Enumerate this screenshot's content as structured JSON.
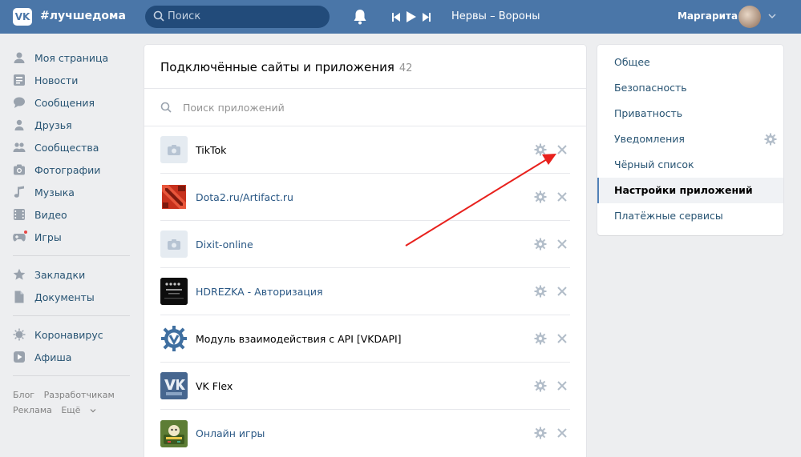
{
  "topbar": {
    "logo_text": "VK",
    "hashtag": "#лучшедома",
    "search_placeholder": "Поиск",
    "now_playing": "Нервы – Вороны",
    "user_name": "Маргарита"
  },
  "nav": {
    "items": [
      {
        "label": "Моя страница",
        "icon": "user-icon"
      },
      {
        "label": "Новости",
        "icon": "news-icon"
      },
      {
        "label": "Сообщения",
        "icon": "messages-icon"
      },
      {
        "label": "Друзья",
        "icon": "friends-icon"
      },
      {
        "label": "Сообщества",
        "icon": "communities-icon"
      },
      {
        "label": "Фотографии",
        "icon": "camera-icon"
      },
      {
        "label": "Музыка",
        "icon": "music-icon"
      },
      {
        "label": "Видео",
        "icon": "video-icon"
      },
      {
        "label": "Игры",
        "icon": "games-icon"
      }
    ],
    "items2": [
      {
        "label": "Закладки",
        "icon": "star-icon"
      },
      {
        "label": "Документы",
        "icon": "document-icon"
      }
    ],
    "items3": [
      {
        "label": "Коронавирус",
        "icon": "virus-icon"
      },
      {
        "label": "Афиша",
        "icon": "play-icon"
      }
    ],
    "footer": {
      "blog": "Блог",
      "developers": "Разработчикам",
      "ads": "Реклама",
      "more": "Ещё"
    }
  },
  "main": {
    "title": "Подключённые сайты и приложения",
    "count": "42",
    "search_placeholder": "Поиск приложений",
    "apps": [
      {
        "name": "TikTok",
        "thumb": "placeholder",
        "link": false
      },
      {
        "name": "Dota2.ru/Artifact.ru",
        "thumb": "dota",
        "link": true
      },
      {
        "name": "Dixit-online",
        "thumb": "placeholder",
        "link": true
      },
      {
        "name": "HDREZKA - Авторизация",
        "thumb": "hdrezka",
        "link": true
      },
      {
        "name": "Модуль взаимодействия с API [VKDAPI]",
        "thumb": "vkdapi",
        "link": false
      },
      {
        "name": "VK Flex",
        "thumb": "vkflex",
        "link": false
      },
      {
        "name": "Онлайн игры",
        "thumb": "games",
        "link": true
      }
    ]
  },
  "menu": {
    "items": [
      {
        "label": "Общее",
        "active": false
      },
      {
        "label": "Безопасность",
        "active": false
      },
      {
        "label": "Приватность",
        "active": false
      },
      {
        "label": "Уведомления",
        "active": false,
        "gear": true
      },
      {
        "label": "Чёрный список",
        "active": false
      },
      {
        "label": "Настройки приложений",
        "active": true
      },
      {
        "label": "Платёжные сервисы",
        "active": false
      }
    ]
  },
  "colors": {
    "header": "#4a76a8",
    "link": "#2a5885",
    "annotation_arrow": "#e8211d"
  }
}
